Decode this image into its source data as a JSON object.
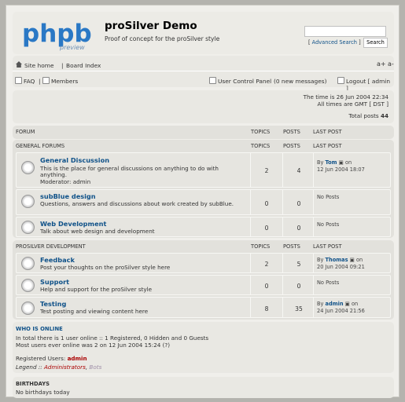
{
  "header": {
    "logo_word": "phpbb",
    "logo_sub": "preview",
    "title": "proSilver Demo",
    "description": "Proof of concept for the proSilver style",
    "search_placeholder": "",
    "advanced_search": "Advanced Search",
    "search_button": "Search"
  },
  "nav": {
    "site_home": "Site home",
    "sep": "|",
    "board_index": "Board Index",
    "font_up": "a+",
    "font_down": "a-",
    "faq": "FAQ",
    "members_sep": "|",
    "members": "Members",
    "ucp": "User Control Panel",
    "new_messages": "(0 new messages)",
    "logout": "Logout [ admin ]"
  },
  "time": {
    "current": "The time is 26 Jun 2004 22:34",
    "zone": "All times are GMT [ DST ]",
    "total_posts_label": "Total posts",
    "total_posts": "44"
  },
  "table_head": {
    "forum": "FORUM",
    "topics": "TOPICS",
    "posts": "POSTS",
    "last_post": "LAST POST"
  },
  "categories": [
    {
      "name": "GENERAL FORUMS",
      "forums": [
        {
          "title": "General Discussion",
          "desc": "This is the place for general discussions on anything to do with anything.",
          "moderator": "Moderator: admin",
          "topics": "2",
          "posts": "4",
          "last_by": "By ",
          "last_user": "Tom",
          "last_on": " on",
          "last_date": "12 Jun 2004 18:07"
        },
        {
          "title": "subBlue design",
          "desc": "Questions, answers and discussions about work created by subBlue.",
          "moderator": "",
          "topics": "0",
          "posts": "0",
          "last_by": "No Posts",
          "last_user": "",
          "last_on": "",
          "last_date": ""
        },
        {
          "title": "Web Development",
          "desc": "Talk about web design and development",
          "moderator": "",
          "topics": "0",
          "posts": "0",
          "last_by": "No Posts",
          "last_user": "",
          "last_on": "",
          "last_date": ""
        }
      ]
    },
    {
      "name": "PROSILVER DEVELOPMENT",
      "forums": [
        {
          "title": "Feedback",
          "desc": "Post your thoughts on the proSilver style here",
          "moderator": "",
          "topics": "2",
          "posts": "5",
          "last_by": "By ",
          "last_user": "Thomas",
          "last_on": " on",
          "last_date": "20 Jun 2004 09:21"
        },
        {
          "title": "Support",
          "desc": "Help and support for the proSilver style",
          "moderator": "",
          "topics": "0",
          "posts": "0",
          "last_by": "No Posts",
          "last_user": "",
          "last_on": "",
          "last_date": ""
        },
        {
          "title": "Testing",
          "desc": "Test posting and viewing content here",
          "moderator": "",
          "topics": "8",
          "posts": "35",
          "last_by": "By ",
          "last_user": "admin",
          "last_on": " on",
          "last_date": "24 Jun 2004 21:56"
        }
      ]
    }
  ],
  "online": {
    "title": "WHO IS ONLINE",
    "line1": "In total there is 1 user online :: 1 Registered, 0 Hidden and 0 Guests",
    "line2": "Most users ever online was 2 on 12 Jun 2004 15:24 (?)",
    "registered_label": "Registered Users:",
    "registered_user": "admin",
    "legend_label": "Legend ::",
    "legend_admin": "Administrators",
    "legend_bots": "Bots"
  },
  "birthdays": {
    "title": "BIRTHDAYS",
    "text": "No birthdays today"
  },
  "colors": {
    "link": "#105289",
    "admin": "#aa0000",
    "logo_blue": "#2a78c5"
  }
}
